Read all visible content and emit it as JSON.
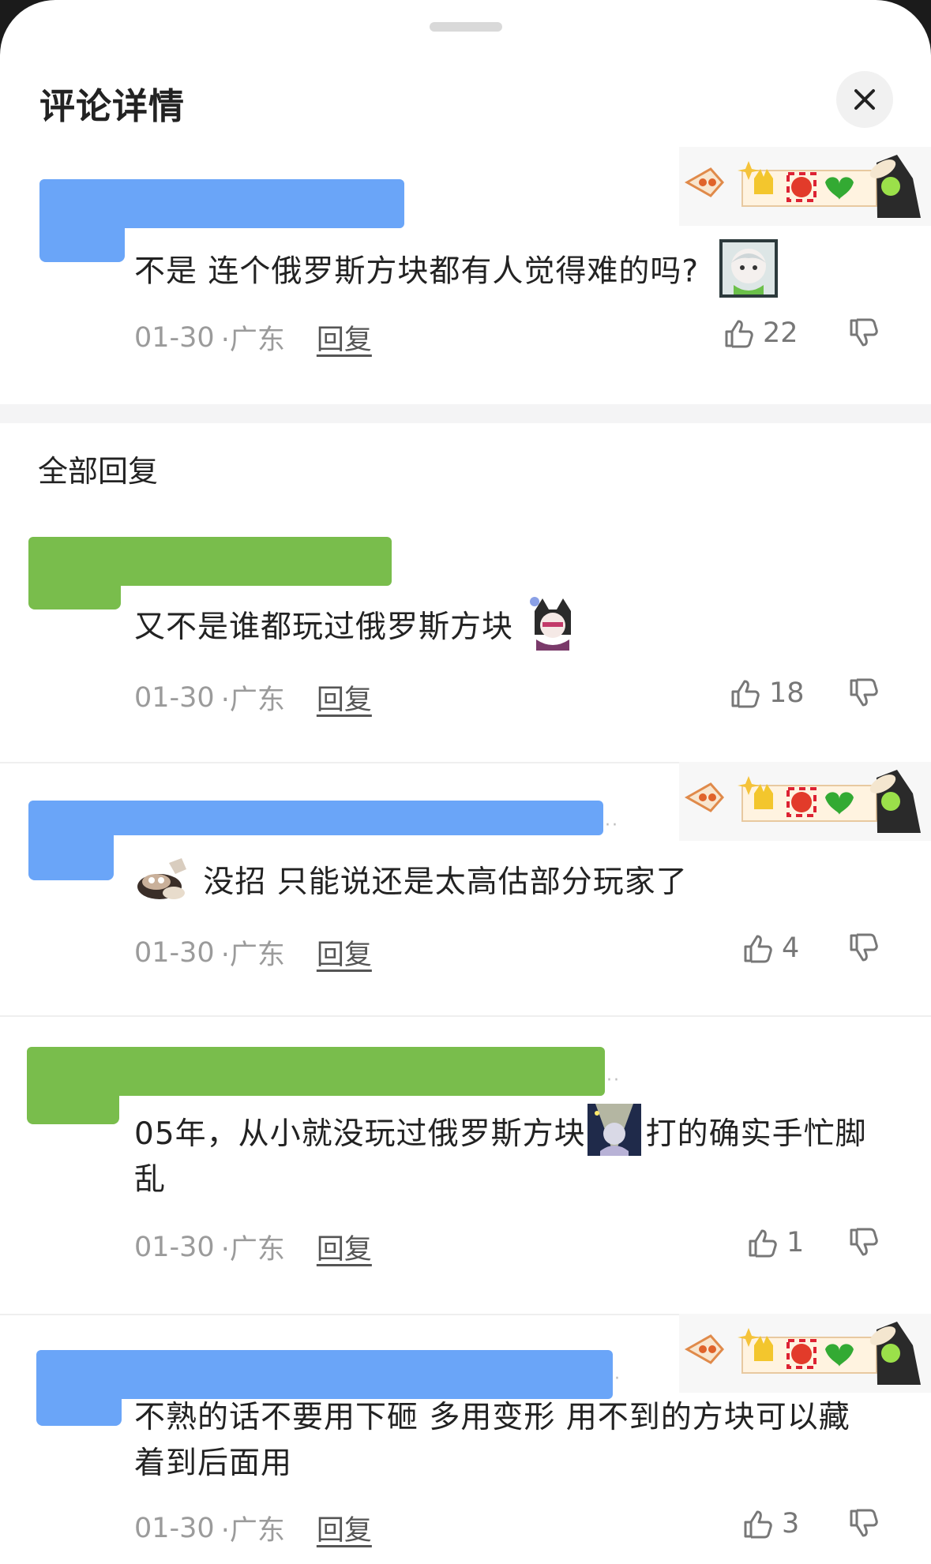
{
  "header": {
    "title": "评论详情"
  },
  "main_comment": {
    "text": "不是 连个俄罗斯方块都有人觉得难的吗?",
    "date": "01-30",
    "location": "·广东",
    "reply_label": "回复",
    "likes": "22"
  },
  "section": {
    "title": "全部回复"
  },
  "replies": [
    {
      "text": "又不是谁都玩过俄罗斯方块",
      "date": "01-30",
      "location": "·广东",
      "reply_label": "回复",
      "likes": "18"
    },
    {
      "text": "没招 只能说还是太高估部分玩家了",
      "date": "01-30",
      "location": "·广东",
      "reply_label": "回复",
      "likes": "4"
    },
    {
      "text_part1": "05年，从小就没玩过俄罗斯方块",
      "text_part2": "打的确实手忙脚乱",
      "date": "01-30",
      "location": "·广东",
      "reply_label": "回复",
      "likes": "1"
    },
    {
      "text": "不熟的话不要用下砸 多用变形 用不到的方块可以藏着到后面用",
      "date": "01-30",
      "location": "·广东",
      "reply_label": "回复",
      "likes": "3"
    }
  ],
  "icons": {
    "close": "close-icon",
    "like": "thumbs-up-icon",
    "dislike": "thumbs-down-icon"
  },
  "colors": {
    "redact_blue": "#6aa5f8",
    "redact_green": "#79bd4c",
    "meta_gray": "#9b9b9b"
  }
}
